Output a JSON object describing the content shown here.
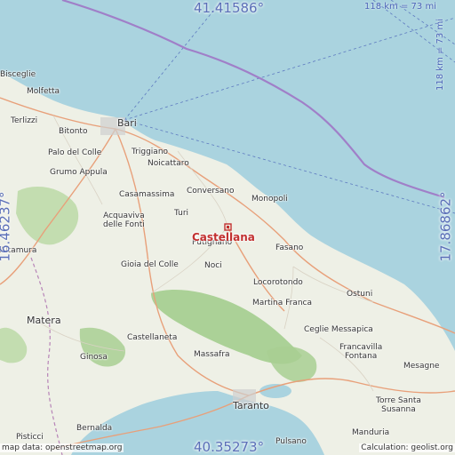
{
  "colors": {
    "sea": "#aad3df",
    "land": "#eef0e6",
    "forest": "#a8cf92",
    "route": "#a07fc8",
    "bound_line": "#4a63b8",
    "road": "#e8a07a",
    "marker": "#c23030"
  },
  "coords": {
    "north": "41.41586°",
    "south": "40.35273°",
    "west": "16.46237°",
    "east": "17.86862°"
  },
  "scale": {
    "top": "118 km = 73 mi",
    "right": "118 km = 73 mi"
  },
  "target": {
    "name": "Castellana",
    "marker_icon": "location-square-icon"
  },
  "places": [
    "Bisceglie",
    "Molfetta",
    "Terlizzi",
    "Bari",
    "Bitonto",
    "Triggiano",
    "Palo del Colle",
    "Noicattaro",
    "Grumo Appula",
    "Casamassima",
    "Conversano",
    "Monopoli",
    "Acquaviva\ndelle Fonti",
    "Turi",
    "Putignano",
    "Altamura",
    "Gioia del Colle",
    "Noci",
    "Fasano",
    "Locorotondo",
    "Ostuni",
    "Matera",
    "Martina Franca",
    "Ceglie Messapica",
    "Castellaneta",
    "Ginosa",
    "Massafra",
    "Francavilla\nFontana",
    "Mesagne",
    "Taranto",
    "Torre Santa\nSusanna",
    "Bernalda",
    "Pisticci",
    "Pulsano",
    "Manduria"
  ],
  "attribution": {
    "left": "map data: openstreetmap.org",
    "right": "Calculation: geolist.org"
  }
}
